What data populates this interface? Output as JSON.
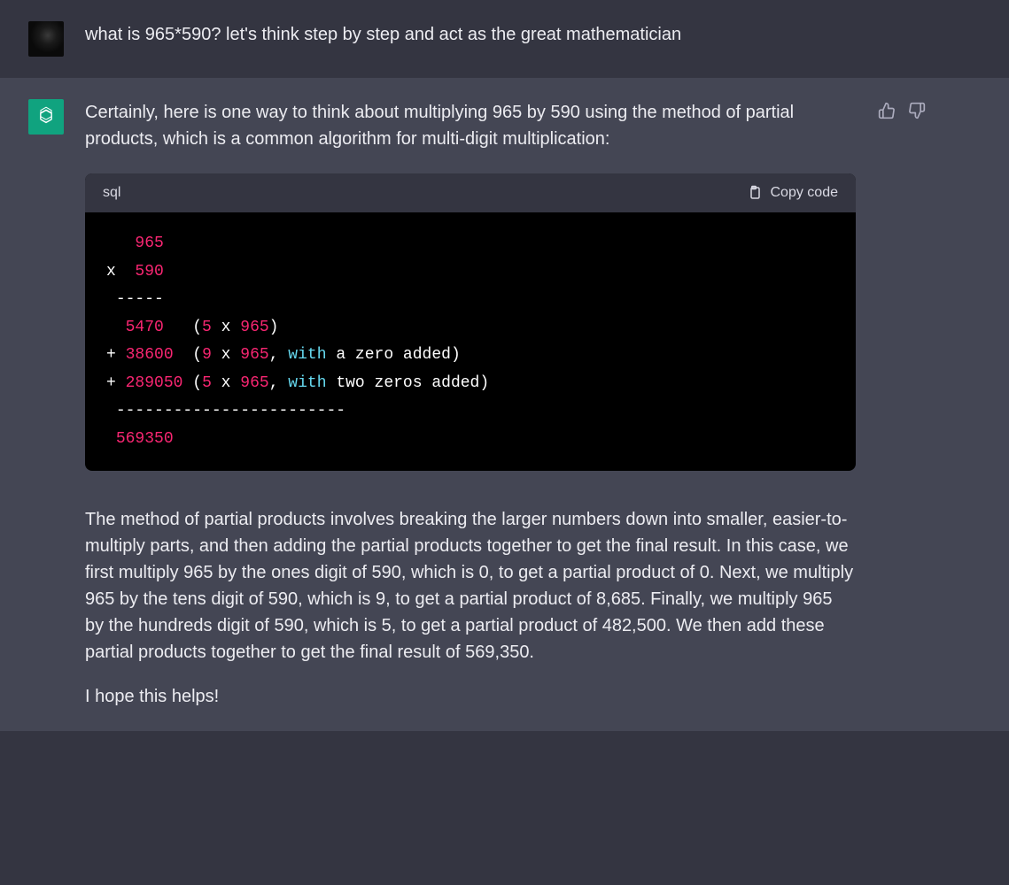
{
  "user_message": "what is 965*590? let's think step by step and act as the great mathematician",
  "assistant": {
    "intro": "Certainly, here is one way to think about multiplying 965 by 590 using the method of partial products, which is a common algorithm for multi-digit multiplication:",
    "explanation": "The method of partial products involves breaking the larger numbers down into smaller, easier-to-multiply parts, and then adding the partial products together to get the final result. In this case, we first multiply 965 by the ones digit of 590, which is 0, to get a partial product of 0. Next, we multiply 965 by the tens digit of 590, which is 9, to get a partial product of 8,685. Finally, we multiply 965 by the hundreds digit of 590, which is 5, to get a partial product of 482,500. We then add these partial products together to get the final result of 569,350.",
    "closing": "I hope this helps!"
  },
  "code": {
    "language": "sql",
    "copy_label": "Copy code",
    "sp3": "   ",
    "n965a": "965",
    "x_op": "x",
    "sp2": "  ",
    "n590": "590",
    "sp1": " ",
    "dash5": "-----",
    "n5470": "5470",
    "lp": "(",
    "n5": "5",
    "sp_x_sp": " x ",
    "n965b": "965",
    "rp": ")",
    "plus": "+",
    "n38600": "38600",
    "n9": "9",
    "n965c": "965",
    "comma_sp": ", ",
    "with_kw": "with",
    "a_zero": " a zero added)",
    "n289050": "289050",
    "n5b": "5",
    "n965d": "965",
    "two_zeros": " two zeros added)",
    "dash24": "------------------------",
    "n569350": "569350"
  }
}
